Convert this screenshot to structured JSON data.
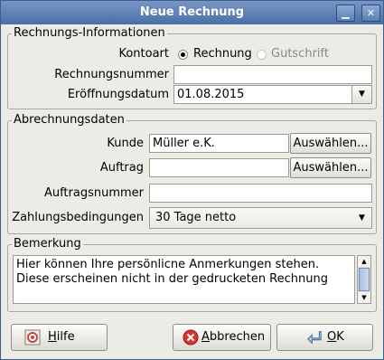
{
  "window": {
    "title": "Neue Rechnung",
    "min_label": "▁",
    "close_label": "✕"
  },
  "invoice_info": {
    "legend": "Rechnungs-Informationen",
    "account_type_label": "Kontoart",
    "options": [
      "Rechnung",
      "Gutschrift"
    ],
    "selected": "Rechnung",
    "number_label": "Rechnungsnummer",
    "number_value": "",
    "date_label": "Eröffnungsdatum",
    "date_value": "01.08.2015"
  },
  "billing": {
    "legend": "Abrechnungsdaten",
    "customer_label": "Kunde",
    "customer_value": "Müller e.K.",
    "order_label": "Auftrag",
    "order_value": "",
    "order_number_label": "Auftragsnummer",
    "order_number_value": "",
    "terms_label": "Zahlungsbedingungen",
    "terms_value": "30 Tage netto",
    "select_label": "Auswählen..."
  },
  "remark": {
    "legend": "Bemerkung",
    "text_line1": "Hier können Ihre persönlicne Anmerkungen stehen.",
    "text_line2": "Diese erscheinen nicht in der gedrucketen Rechnung"
  },
  "buttons": {
    "help_first": "H",
    "help_rest": "ilfe",
    "cancel_first": "A",
    "cancel_rest": "bbrechen",
    "ok_first": "O",
    "ok_rest": "K"
  },
  "icons": {
    "help": "help-icon",
    "cancel": "cancel-icon",
    "ok": "ok-icon",
    "dropdown": "chevron-down-icon"
  }
}
